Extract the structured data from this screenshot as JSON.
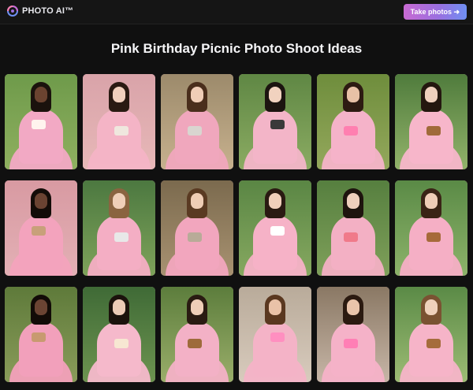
{
  "header": {
    "brand": "PHOTO AI™",
    "cta_label": "Take photos ➜",
    "cta_colors": [
      "#c86ad2",
      "#6f8ff2"
    ]
  },
  "page": {
    "title": "Pink Birthday Picnic Photo Shoot Ideas"
  },
  "gallery": {
    "rows": 3,
    "columns": 6,
    "tiles": [
      {
        "name": "photo-birthday-hat-cake",
        "bg": [
          "#6e9a4a",
          "#8fb060"
        ],
        "hair": "#1b120d",
        "skin": "#6b4330",
        "dress": "#f2a9c4",
        "prop": "#fff3ee"
      },
      {
        "name": "photo-holding-white-cat",
        "bg": [
          "#d9a3a9",
          "#e7b8b8"
        ],
        "hair": "#2a1a12",
        "skin": "#f1d0bd",
        "dress": "#f4b4c6",
        "prop": "#efe7de"
      },
      {
        "name": "photo-hugging-cat-garden",
        "bg": [
          "#9c8a6b",
          "#c7b18e"
        ],
        "hair": "#4a2e1c",
        "skin": "#efcdb7",
        "dress": "#f0a7bd",
        "prop": "#d9d5d0"
      },
      {
        "name": "photo-camera-pink-dress",
        "bg": [
          "#5f8744",
          "#8bab62"
        ],
        "hair": "#1c1410",
        "skin": "#f1d2bf",
        "dress": "#f3b5c8",
        "prop": "#3a3a3a"
      },
      {
        "name": "photo-lying-sunglasses",
        "bg": [
          "#6e8d3c",
          "#94a85c"
        ],
        "hair": "#2d1b12",
        "skin": "#e8c1a6",
        "dress": "#f5b3c9",
        "prop": "#ff7fb0"
      },
      {
        "name": "photo-bow-basket-meadow",
        "bg": [
          "#4f7b3c",
          "#92b36a"
        ],
        "hair": "#24170f",
        "skin": "#efd0bd",
        "dress": "#f7b6ca",
        "prop": "#a06a3a"
      },
      {
        "name": "photo-afro-kitten-pink-wall",
        "bg": [
          "#d89aa2",
          "#e3b0b5"
        ],
        "hair": "#130c08",
        "skin": "#6a4332",
        "dress": "#f3a3bd",
        "prop": "#c8a07a"
      },
      {
        "name": "photo-camera-outdoor-park",
        "bg": [
          "#4c7840",
          "#7ea35a"
        ],
        "hair": "#8a6440",
        "skin": "#efcfb8",
        "dress": "#f4aec4",
        "prop": "#e8e8e8"
      },
      {
        "name": "photo-tabby-cat-fence",
        "bg": [
          "#7b6a4e",
          "#a89271"
        ],
        "hair": "#5a3a22",
        "skin": "#efcdb5",
        "dress": "#f2a6be",
        "prop": "#b8ab98"
      },
      {
        "name": "photo-bow-cake-picnic",
        "bg": [
          "#5a8644",
          "#86a860"
        ],
        "hair": "#2a1a12",
        "skin": "#f0cfbb",
        "dress": "#f6b2c7",
        "prop": "#ffffff"
      },
      {
        "name": "photo-pouring-drink",
        "bg": [
          "#567f3f",
          "#7fa05a"
        ],
        "hair": "#1e140e",
        "skin": "#eecfbc",
        "dress": "#f3b0c4",
        "prop": "#f07a8a"
      },
      {
        "name": "photo-cake-basket-lawn",
        "bg": [
          "#5a8a46",
          "#8db36a"
        ],
        "hair": "#3a2416",
        "skin": "#efcdb7",
        "dress": "#f5afc5",
        "prop": "#a66a3a"
      },
      {
        "name": "photo-afro-cat-roses",
        "bg": [
          "#5e7a3a",
          "#8a9c5a"
        ],
        "hair": "#120b07",
        "skin": "#6b4433",
        "dress": "#f2a0bb",
        "prop": "#c89a70"
      },
      {
        "name": "photo-champagne-flowers",
        "bg": [
          "#3f6a36",
          "#6d9450"
        ],
        "hair": "#1b120c",
        "skin": "#eccbb6",
        "dress": "#f5b9cb",
        "prop": "#f7e7d2"
      },
      {
        "name": "photo-camera-basket-field",
        "bg": [
          "#5c7d3c",
          "#9aae6a"
        ],
        "hair": "#2a1b12",
        "skin": "#efceb8",
        "dress": "#f3b1c6",
        "prop": "#9e6b3b"
      },
      {
        "name": "photo-lying-pink-sunglasses",
        "bg": [
          "#b9ab9a",
          "#d8cbbd"
        ],
        "hair": "#5a3820",
        "skin": "#e9c2a8",
        "dress": "#f4b3c7",
        "prop": "#ff8fc0"
      },
      {
        "name": "photo-heart-sunglasses-blanket",
        "bg": [
          "#8a7864",
          "#c7b6a7"
        ],
        "hair": "#2b1a10",
        "skin": "#e9c4aa",
        "dress": "#f5b2c8",
        "prop": "#ff7fb5"
      },
      {
        "name": "photo-bow-basket-standing",
        "bg": [
          "#5a8a46",
          "#9dbc74"
        ],
        "hair": "#7a5232",
        "skin": "#efd1bc",
        "dress": "#f6b4c8",
        "prop": "#a56c3c"
      }
    ]
  }
}
